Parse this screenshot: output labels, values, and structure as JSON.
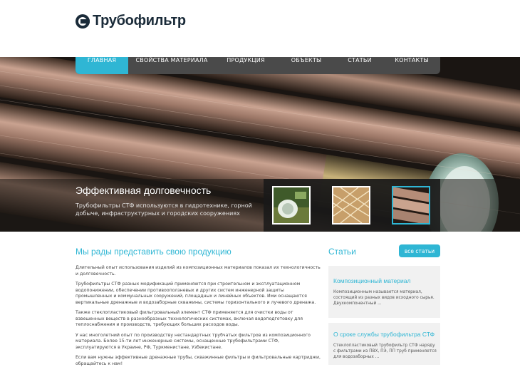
{
  "logo": {
    "text": "Трубофильтр",
    "icon": "logo-mark-icon"
  },
  "nav": {
    "items": [
      {
        "label": "ГЛАВНАЯ",
        "active": true
      },
      {
        "label": "СВОЙСТВА МАТЕРИАЛА",
        "active": false
      },
      {
        "label": "ПРОДУКЦИЯ",
        "active": false
      },
      {
        "label": "ОБЪЕКТЫ",
        "active": false
      },
      {
        "label": "СТАТЬИ",
        "active": false
      },
      {
        "label": "КОНТАКТЫ",
        "active": false
      }
    ]
  },
  "hero": {
    "title": "Эффективная долговечность",
    "text": "Трубофильтры СТФ используются в гидротехнике, горной добыче, инфраструктурных и городских сооружениях"
  },
  "main": {
    "title": "Мы рады представить свою продукцию",
    "paragraphs": [
      "Длительный опыт использования изделий из композиционных материалов показал их технологичность и долговечность.",
      "Трубофильтры СТФ разных модификаций применяются при строительном и эксплуатационном водопонижении, обеспечении противооползневых и других систем инженерной защиты промышленных и коммунальных сооружений, площадных и линейных объектов. Ими оснащаются вертикальные дренажные и водозаборные скважины, системы горизонтального и лучевого дренажа.",
      "Также стеклопластиковый фильтровальный элемент СТФ применяется для очистки воды от взвешенных веществ в разнообразных технологических системах, включая водоподготовку для теплоснабжения и производств, требующих больших расходов воды.",
      "У нас многолетний опыт по производству нестандартных трубчатых фильтров из композиционного материала. Более 15-ти лет инженерные системы, оснащенные трубофильтрами СТФ, эксплуатируются в Украине, РФ, Туркменистане, Узбекистане.",
      "Если вам нужны эффективные дренажные трубы, скважинные фильтры и фильтровальные картриджи, обращайтесь к нам!"
    ]
  },
  "sidebar": {
    "title": "Статьи",
    "all_button": "все статьи",
    "cards": [
      {
        "title": "Композиционный материал",
        "text": "Композиционным называется материал, состоящий из разных видов исходного сырья. Двухкомпонентный ..."
      },
      {
        "title": "О сроке службы трубофильтра СТФ",
        "text": "Стеклопластиковый трубофильтр СТФ наряду с фильтрами из ПВХ, ПЭ, ПП труб применяется для водозаборных ..."
      }
    ]
  },
  "colors": {
    "accent": "#2fb6d4",
    "nav_bg": "#4a4a4a",
    "logo": "#1a2b39",
    "card_bg": "#f1f1f1"
  }
}
